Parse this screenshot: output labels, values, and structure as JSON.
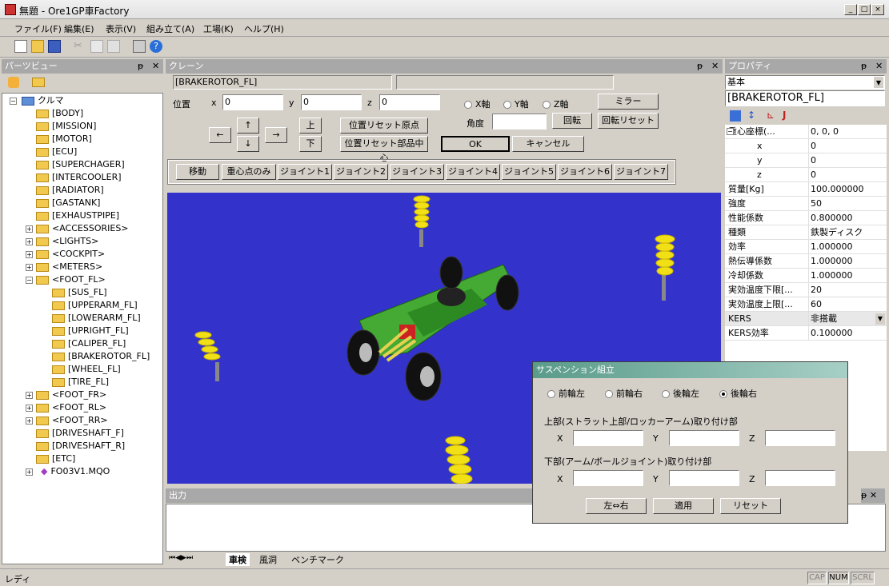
{
  "window": {
    "title": "無題 - Ore1GP車Factory",
    "min": "_",
    "max": "□",
    "close": "×"
  },
  "menu": [
    "ファイル(F)",
    "編集(E)",
    "表示(V)",
    "組み立て(A)",
    "工場(K)",
    "ヘルプ(H)"
  ],
  "parts_view": {
    "title": "パーツビュー",
    "items": [
      "クルマ",
      "[BODY]",
      "[MISSION]",
      "[MOTOR]",
      "[ECU]",
      "[SUPERCHAGER]",
      "[INTERCOOLER]",
      "[RADIATOR]",
      "[GASTANK]",
      "[EXHAUSTPIPE]",
      "<ACCESSORIES>",
      "<LIGHTS>",
      "<COCKPIT>",
      "<METERS>",
      "<FOOT_FL>",
      "[SUS_FL]",
      "[UPPERARM_FL]",
      "[LOWERARM_FL]",
      "[UPRIGHT_FL]",
      "[CALIPER_FL]",
      "[BRAKEROTOR_FL]",
      "[WHEEL_FL]",
      "[TIRE_FL]",
      "<FOOT_FR>",
      "<FOOT_RL>",
      "<FOOT_RR>",
      "[DRIVESHAFT_F]",
      "[DRIVESHAFT_R]",
      "[ETC]",
      "FO03V1.MQO"
    ]
  },
  "crane": {
    "title": "クレーン",
    "selected": "[BRAKEROTOR_FL]",
    "position_label": "位置",
    "x_label": "x",
    "y_label": "y",
    "z_label": "z",
    "x_value": "0",
    "y_value": "0",
    "z_value": "0",
    "arrows": {
      "left": "←",
      "up": "↑",
      "down": "↓",
      "right": "→"
    },
    "up_btn": "上",
    "down_btn": "下",
    "reset_origin": "位置リセット原点",
    "reset_center": "位置リセット部品中心",
    "axes": [
      "X軸",
      "Y軸",
      "Z軸"
    ],
    "angle_label": "角度",
    "rotate": "回転",
    "rotate_reset": "回転リセット",
    "mirror": "ミラー",
    "ok": "OK",
    "cancel": "キャンセル",
    "modes": [
      "移動",
      "重心点のみ",
      "ジョイント1",
      "ジョイント2",
      "ジョイント3",
      "ジョイント4",
      "ジョイント5",
      "ジョイント6",
      "ジョイント7"
    ]
  },
  "properties": {
    "title": "プロパティ",
    "combo": "基本",
    "name": "[BRAKEROTOR_FL]",
    "rows": [
      [
        "重心座標(...",
        "0, 0, 0"
      ],
      [
        "x",
        "0"
      ],
      [
        "y",
        "0"
      ],
      [
        "z",
        "0"
      ],
      [
        "質量[Kg]",
        "100.000000"
      ],
      [
        "強度",
        "50"
      ],
      [
        "性能係数",
        "0.800000"
      ],
      [
        "種類",
        "鉄製ディスク"
      ],
      [
        "効率",
        "1.000000"
      ],
      [
        "熱伝導係数",
        "1.000000"
      ],
      [
        "冷却係数",
        "1.000000"
      ],
      [
        "実効温度下限[...",
        "20"
      ],
      [
        "実効温度上限[...",
        "60"
      ],
      [
        "KERS",
        "非搭載"
      ],
      [
        "KERS効率",
        "0.100000"
      ]
    ]
  },
  "output": {
    "title": "出力",
    "tabs": [
      "車検",
      "風洞",
      "ベンチマーク"
    ]
  },
  "dialog": {
    "title": "サスペンション組立",
    "radios": [
      "前輪左",
      "前輪右",
      "後輪左",
      "後輪右"
    ],
    "upper_label": "上部(ストラット上部/ロッカーアーム)取り付け部",
    "lower_label": "下部(アーム/ボールジョイント)取り付け部",
    "X": "X",
    "Y": "Y",
    "Z": "Z",
    "swap": "左⇔右",
    "apply": "適用",
    "reset": "リセット"
  },
  "status": {
    "text": "レディ",
    "cap": "CAP",
    "num": "NUM",
    "scrl": "SCRL"
  },
  "colors": {
    "viewport": "#3333cc",
    "car_body": "#44aa33",
    "spring": "#f2e017"
  }
}
